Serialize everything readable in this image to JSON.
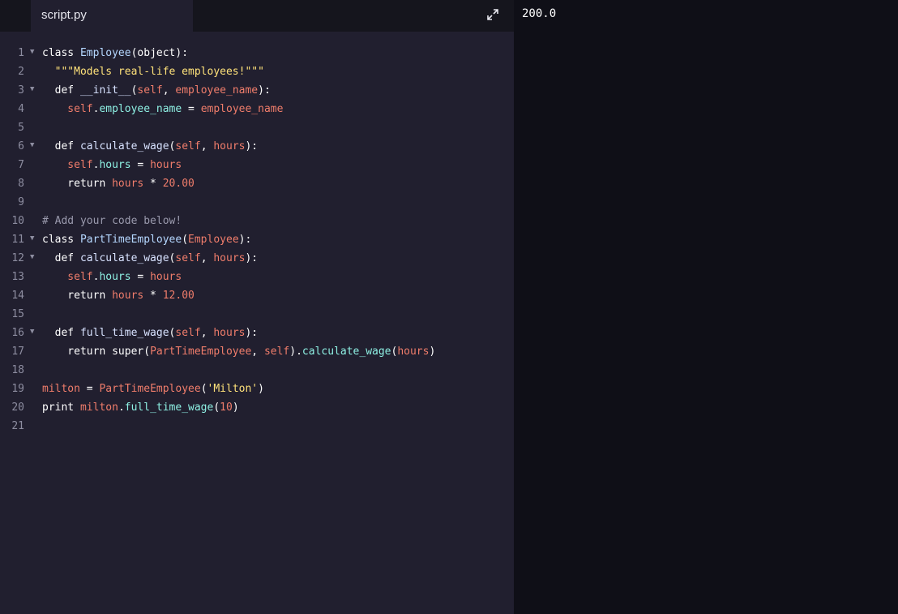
{
  "editor": {
    "tab_label": "script.py",
    "expand_icon": "expand-icon",
    "lines": [
      {
        "n": "1",
        "fold": true,
        "tokens": [
          {
            "c": "kw",
            "t": "class "
          },
          {
            "c": "cls",
            "t": "Employee"
          },
          {
            "c": "kw",
            "t": "(object):"
          }
        ]
      },
      {
        "n": "2",
        "fold": false,
        "tokens": [
          {
            "c": "str",
            "t": "  \"\"\"Models real-life employees!\"\"\""
          }
        ]
      },
      {
        "n": "3",
        "fold": true,
        "tokens": [
          {
            "c": "kw",
            "t": "  def "
          },
          {
            "c": "fn",
            "t": "__init__"
          },
          {
            "c": "kw",
            "t": "("
          },
          {
            "c": "p",
            "t": "self"
          },
          {
            "c": "kw",
            "t": ", "
          },
          {
            "c": "p",
            "t": "employee_name"
          },
          {
            "c": "kw",
            "t": "):"
          }
        ]
      },
      {
        "n": "4",
        "fold": false,
        "tokens": [
          {
            "c": "p",
            "t": "    self"
          },
          {
            "c": "kw",
            "t": "."
          },
          {
            "c": "at",
            "t": "employee_name"
          },
          {
            "c": "kw",
            "t": " = "
          },
          {
            "c": "p",
            "t": "employee_name"
          }
        ]
      },
      {
        "n": "5",
        "fold": false,
        "tokens": []
      },
      {
        "n": "6",
        "fold": true,
        "tokens": [
          {
            "c": "kw",
            "t": "  def "
          },
          {
            "c": "fn",
            "t": "calculate_wage"
          },
          {
            "c": "kw",
            "t": "("
          },
          {
            "c": "p",
            "t": "self"
          },
          {
            "c": "kw",
            "t": ", "
          },
          {
            "c": "p",
            "t": "hours"
          },
          {
            "c": "kw",
            "t": "):"
          }
        ]
      },
      {
        "n": "7",
        "fold": false,
        "tokens": [
          {
            "c": "p",
            "t": "    self"
          },
          {
            "c": "kw",
            "t": "."
          },
          {
            "c": "at",
            "t": "hours"
          },
          {
            "c": "kw",
            "t": " = "
          },
          {
            "c": "p",
            "t": "hours"
          }
        ]
      },
      {
        "n": "8",
        "fold": false,
        "tokens": [
          {
            "c": "kw",
            "t": "    return "
          },
          {
            "c": "p",
            "t": "hours"
          },
          {
            "c": "kw",
            "t": " * "
          },
          {
            "c": "num",
            "t": "20.00"
          }
        ]
      },
      {
        "n": "9",
        "fold": false,
        "tokens": []
      },
      {
        "n": "10",
        "fold": false,
        "tokens": [
          {
            "c": "cm",
            "t": "# Add your code below!"
          }
        ]
      },
      {
        "n": "11",
        "fold": true,
        "tokens": [
          {
            "c": "kw",
            "t": "class "
          },
          {
            "c": "cls",
            "t": "PartTimeEmployee"
          },
          {
            "c": "kw",
            "t": "("
          },
          {
            "c": "p",
            "t": "Employee"
          },
          {
            "c": "kw",
            "t": "):"
          }
        ]
      },
      {
        "n": "12",
        "fold": true,
        "tokens": [
          {
            "c": "kw",
            "t": "  def "
          },
          {
            "c": "fn",
            "t": "calculate_wage"
          },
          {
            "c": "kw",
            "t": "("
          },
          {
            "c": "p",
            "t": "self"
          },
          {
            "c": "kw",
            "t": ", "
          },
          {
            "c": "p",
            "t": "hours"
          },
          {
            "c": "kw",
            "t": "):"
          }
        ]
      },
      {
        "n": "13",
        "fold": false,
        "tokens": [
          {
            "c": "p",
            "t": "    self"
          },
          {
            "c": "kw",
            "t": "."
          },
          {
            "c": "at",
            "t": "hours"
          },
          {
            "c": "kw",
            "t": " = "
          },
          {
            "c": "p",
            "t": "hours"
          }
        ]
      },
      {
        "n": "14",
        "fold": false,
        "tokens": [
          {
            "c": "kw",
            "t": "    return "
          },
          {
            "c": "p",
            "t": "hours"
          },
          {
            "c": "kw",
            "t": " * "
          },
          {
            "c": "num",
            "t": "12.00"
          }
        ]
      },
      {
        "n": "15",
        "fold": false,
        "tokens": []
      },
      {
        "n": "16",
        "fold": true,
        "tokens": [
          {
            "c": "kw",
            "t": "  def "
          },
          {
            "c": "fn",
            "t": "full_time_wage"
          },
          {
            "c": "kw",
            "t": "("
          },
          {
            "c": "p",
            "t": "self"
          },
          {
            "c": "kw",
            "t": ", "
          },
          {
            "c": "p",
            "t": "hours"
          },
          {
            "c": "kw",
            "t": "):"
          }
        ]
      },
      {
        "n": "17",
        "fold": false,
        "tokens": [
          {
            "c": "kw",
            "t": "    return super("
          },
          {
            "c": "p",
            "t": "PartTimeEmployee"
          },
          {
            "c": "kw",
            "t": ", "
          },
          {
            "c": "p",
            "t": "self"
          },
          {
            "c": "kw",
            "t": ")."
          },
          {
            "c": "at",
            "t": "calculate_wage"
          },
          {
            "c": "kw",
            "t": "("
          },
          {
            "c": "p",
            "t": "hours"
          },
          {
            "c": "kw",
            "t": ")"
          }
        ]
      },
      {
        "n": "18",
        "fold": false,
        "tokens": []
      },
      {
        "n": "19",
        "fold": false,
        "tokens": [
          {
            "c": "p",
            "t": "milton"
          },
          {
            "c": "kw",
            "t": " = "
          },
          {
            "c": "p",
            "t": "PartTimeEmployee"
          },
          {
            "c": "kw",
            "t": "("
          },
          {
            "c": "str",
            "t": "'Milton'"
          },
          {
            "c": "kw",
            "t": ")"
          }
        ]
      },
      {
        "n": "20",
        "fold": false,
        "tokens": [
          {
            "c": "kw",
            "t": "print "
          },
          {
            "c": "p",
            "t": "milton"
          },
          {
            "c": "kw",
            "t": "."
          },
          {
            "c": "at",
            "t": "full_time_wage"
          },
          {
            "c": "kw",
            "t": "("
          },
          {
            "c": "num",
            "t": "10"
          },
          {
            "c": "kw",
            "t": ")"
          }
        ]
      },
      {
        "n": "21",
        "fold": false,
        "tokens": []
      }
    ]
  },
  "console": {
    "output": "200.0"
  },
  "colors": {
    "editor_bg": "#211f2f",
    "tabbar_bg": "#15151d",
    "console_bg": "#0f0f17",
    "param": "#f07d6b",
    "attribute": "#8ef0e3",
    "string": "#ffe27a",
    "class_name": "#b5d7ff",
    "comment": "#9a9aad"
  }
}
